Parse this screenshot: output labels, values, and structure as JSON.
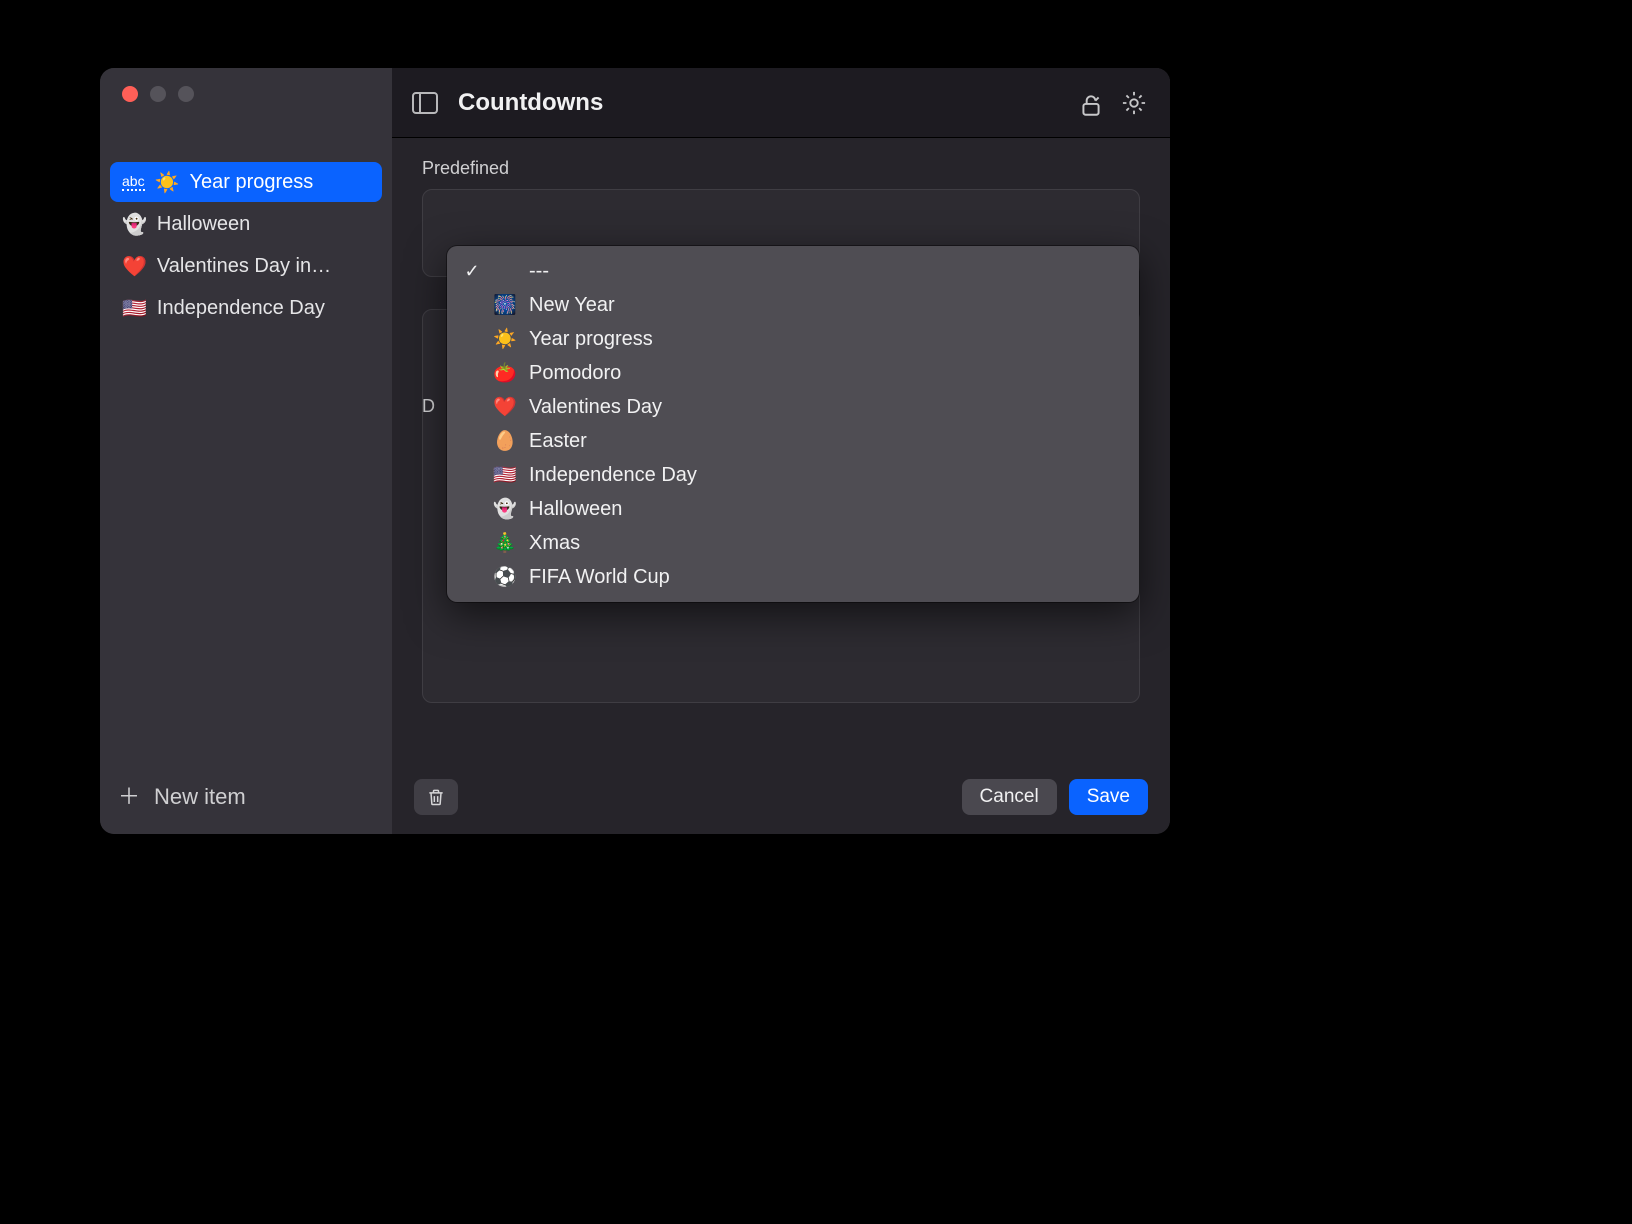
{
  "header": {
    "title": "Countdowns"
  },
  "sidebar": {
    "items": [
      {
        "abc": "abc",
        "emoji": "☀️",
        "label": "Year progress",
        "selected": true
      },
      {
        "emoji": "👻",
        "label": "Halloween"
      },
      {
        "emoji": "❤️",
        "label": "Valentines Day in…"
      },
      {
        "emoji": "🇺🇸",
        "label": "Independence Day"
      }
    ],
    "new_item_label": "New item"
  },
  "content": {
    "predefined_label": "Predefined",
    "details_label_prefix": "D"
  },
  "dropdown": {
    "items": [
      {
        "checked": true,
        "emoji": "",
        "label": "---"
      },
      {
        "emoji": "🎆",
        "label": "New Year"
      },
      {
        "emoji": "☀️",
        "label": "Year progress"
      },
      {
        "emoji": "🍅",
        "label": "Pomodoro"
      },
      {
        "emoji": "❤️",
        "label": "Valentines Day"
      },
      {
        "emoji": "🥚",
        "label": "Easter"
      },
      {
        "emoji": "🇺🇸",
        "label": "Independence Day"
      },
      {
        "emoji": "👻",
        "label": "Halloween"
      },
      {
        "emoji": "🎄",
        "label": "Xmas"
      },
      {
        "emoji": "⚽",
        "label": "FIFA World Cup"
      }
    ]
  },
  "footer": {
    "cancel_label": "Cancel",
    "save_label": "Save"
  }
}
